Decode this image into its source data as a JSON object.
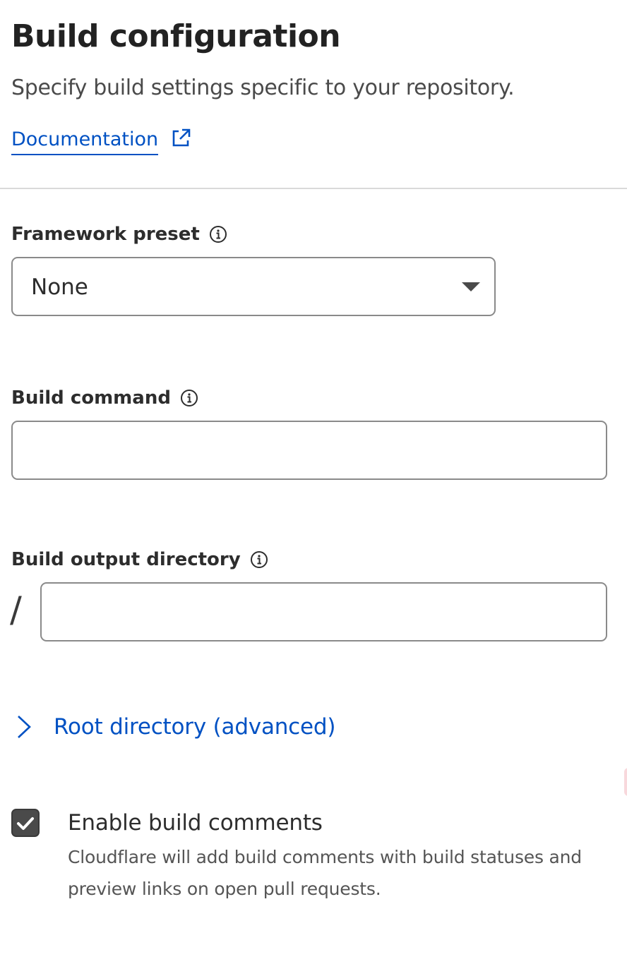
{
  "header": {
    "title": "Build configuration",
    "subtitle": "Specify build settings specific to your repository.",
    "doc_link_label": "Documentation",
    "doc_link_icon": "external-link-icon"
  },
  "framework_preset": {
    "label": "Framework preset",
    "info_icon": "info-icon",
    "selected_value": "None"
  },
  "build_command": {
    "label": "Build command",
    "info_icon": "info-icon",
    "value": "",
    "placeholder": ""
  },
  "build_output_directory": {
    "label": "Build output directory",
    "info_icon": "info-icon",
    "prefix": "/",
    "value": "",
    "placeholder": ""
  },
  "root_directory": {
    "label": "Root directory (advanced)",
    "expanded": false,
    "icon": "chevron-right-icon"
  },
  "build_comments": {
    "label": "Enable build comments",
    "description": "Cloudflare will add build comments with build statuses and preview links on open pull requests.",
    "checked": true
  },
  "colors": {
    "link": "#0051c3",
    "text": "#2d2d2d",
    "border": "#8a8a8a",
    "divider": "#d9d9d9",
    "checkbox": "#4a4a4a"
  }
}
